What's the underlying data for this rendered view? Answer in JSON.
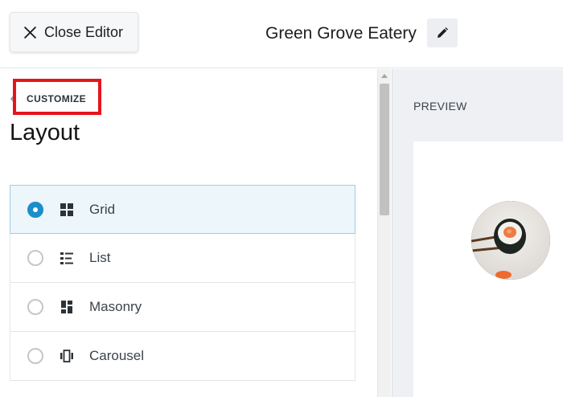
{
  "topbar": {
    "close_label": "Close Editor",
    "feed_title": "Green Grove Eatery"
  },
  "sidebar": {
    "breadcrumb": "CUSTOMIZE",
    "section_title": "Layout",
    "options": [
      {
        "label": "Grid",
        "icon": "grid-icon",
        "selected": true
      },
      {
        "label": "List",
        "icon": "list-icon",
        "selected": false
      },
      {
        "label": "Masonry",
        "icon": "masonry-icon",
        "selected": false
      },
      {
        "label": "Carousel",
        "icon": "carousel-icon",
        "selected": false
      }
    ]
  },
  "preview": {
    "label": "PREVIEW",
    "avatar_icon": "profile-photo-sushi"
  },
  "colors": {
    "accent": "#1b8ec9",
    "highlight_box": "#e5151c",
    "selected_bg": "#ecf6fb"
  }
}
